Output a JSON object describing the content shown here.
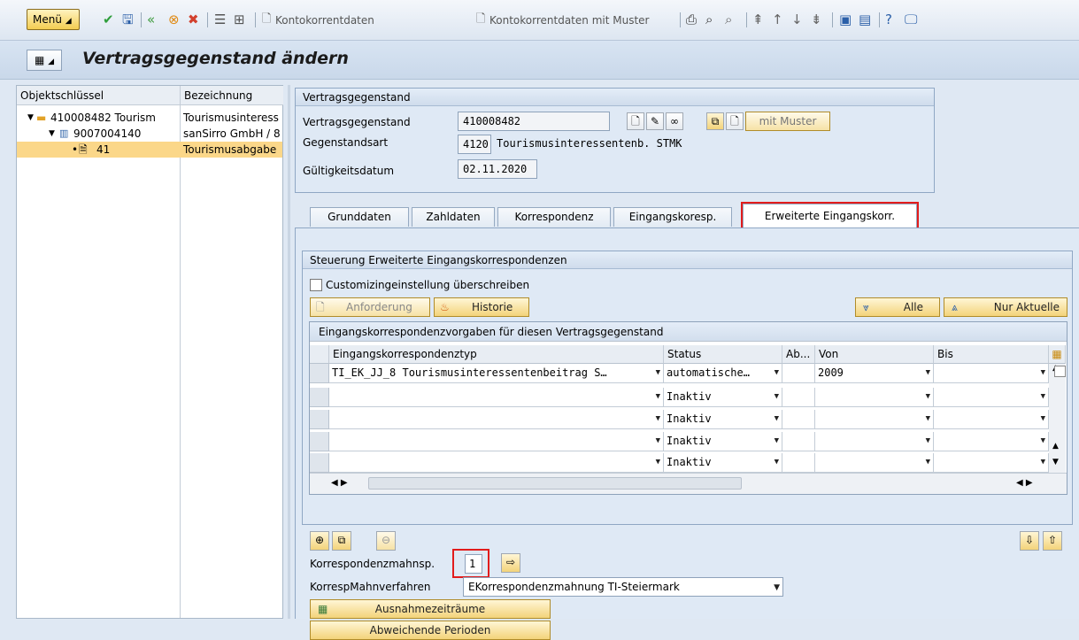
{
  "toolbar": {
    "menu_label": "Menü",
    "kontokorrent": "Kontokorrentdaten",
    "kontokorrent_muster": "Kontokorrentdaten mit Muster"
  },
  "title": "Vertragsgegenstand ändern",
  "tree": {
    "col1": "Objektschlüssel",
    "col2": "Bezeichnung",
    "rows": [
      {
        "key": "410008482 Tourism",
        "desc": "Tourismusinteress"
      },
      {
        "key": "9007004140",
        "desc": "sanSirro GmbH / 8"
      },
      {
        "key": "41",
        "desc": "Tourismusabgabe"
      }
    ]
  },
  "vg": {
    "header": "Vertragsgegenstand",
    "lbl_vg": "Vertragsgegenstand",
    "val_vg": "410008482",
    "lbl_art": "Gegenstandsart",
    "val_art_code": "4120",
    "val_art_text": "Tourismusinteressentenb. STMK",
    "lbl_datum": "Gültigkeitsdatum",
    "val_datum": "02.11.2020",
    "mit_muster": "mit Muster"
  },
  "tabs": [
    "Grunddaten",
    "Zahldaten",
    "Korrespondenz",
    "Eingangskoresp.",
    "Erweiterte Eingangskorr."
  ],
  "steuerung": {
    "header": "Steuerung Erweiterte Eingangskorrespondenzen",
    "checkbox": "Customizingeinstellung überschreiben",
    "anforderung": "Anforderung",
    "historie": "Historie",
    "alle": "Alle",
    "nur_aktuelle": "Nur Aktuelle"
  },
  "grid": {
    "title": "Eingangskorrespondenzvorgaben für diesen Vertragsgegenstand",
    "columns": [
      "Eingangskorrespondenztyp",
      "Status",
      "Ab...",
      "Von",
      "Bis"
    ],
    "rows": [
      {
        "typ": "TI_EK_JJ_8 Tourismusinteressentenbeitrag S…",
        "status": "automatische…",
        "ab": "",
        "von": "2009",
        "bis": ""
      },
      {
        "typ": "",
        "status": "Inaktiv",
        "ab": "",
        "von": "",
        "bis": ""
      },
      {
        "typ": "",
        "status": "Inaktiv",
        "ab": "",
        "von": "",
        "bis": ""
      },
      {
        "typ": "",
        "status": "Inaktiv",
        "ab": "",
        "von": "",
        "bis": ""
      },
      {
        "typ": "",
        "status": "Inaktiv",
        "ab": "",
        "von": "",
        "bis": ""
      }
    ]
  },
  "lower": {
    "lbl_mahnsp": "Korrespondenzmahnsp.",
    "val_mahnsp": "1",
    "lbl_verfahren": "KorrespMahnverfahren",
    "val_verfahren": "EKorrespondenzmahnung TI-Steiermark",
    "btn_ausnahme": "Ausnahmezeiträume",
    "btn_perioden": "Abweichende Perioden"
  }
}
